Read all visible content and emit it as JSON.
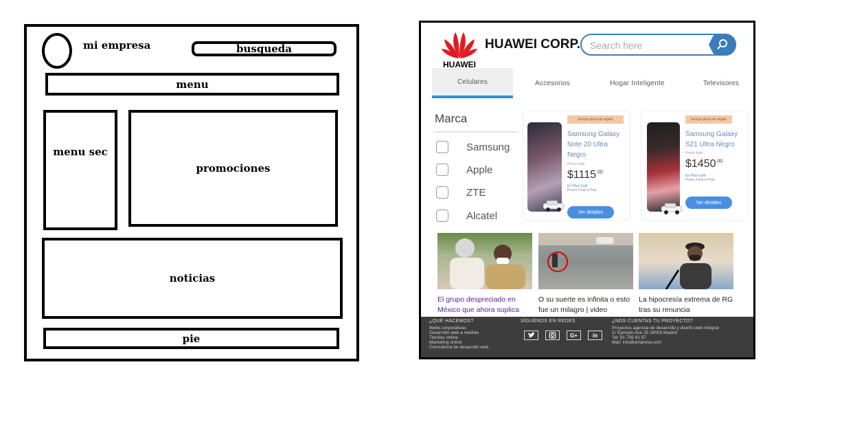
{
  "wireframe": {
    "company": "mi empresa",
    "search": "busqueda",
    "menu": "menu",
    "menu_sec": "menu sec",
    "promos": "promociones",
    "news": "noticias",
    "footer": "pie"
  },
  "site": {
    "logo_text": "HUAWEI",
    "brand": "HUAWEI CORP.",
    "search_placeholder": "Search here",
    "accent": "#3e8ad0",
    "tabs": [
      {
        "label": "Celulares",
        "active": true
      },
      {
        "label": "Accesorios",
        "active": false
      },
      {
        "label": "Hogar Inteligente",
        "active": false
      },
      {
        "label": "Televisores",
        "active": false
      }
    ],
    "filter": {
      "title": "Marca",
      "items": [
        "Samsung",
        "Apple",
        "ZTE",
        "Alcatel"
      ]
    },
    "products": [
      {
        "badge": "Incluye pieza de regalo",
        "name": "Samsung Galaxy Note 20 Ultra Negro",
        "note": "Precio total",
        "price": "$1115",
        "cents": ".00",
        "plan": "En Plan Gold",
        "plan_detail": "Precio Final el Plan",
        "button": "Ver detalles"
      },
      {
        "badge": "Incluye pieza de regalo",
        "name": "Samsung Galaxy S21 Ultra Negro",
        "note": "Precio total",
        "price": "$1450",
        "cents": ".00",
        "plan": "En Plan Gold",
        "plan_detail": "Precio Final el Plan",
        "button": "Ver detalles"
      }
    ],
    "news": [
      {
        "title": "El grupo despreciado en México que ahora suplica"
      },
      {
        "title": "O su suerte es infinita o esto fue un milagro | video"
      },
      {
        "title": "La hipocresía extrema de RG tras su renuncia"
      }
    ],
    "footer": {
      "col1_head": "¿QUÉ HACEMOS?",
      "col1_items": [
        "Webs corporativas",
        "Desarrollo web a medida",
        "Tiendas online",
        "Marketing online",
        "Consultoría de desarrollo web"
      ],
      "col2_head": "SÍGUENOS EN REDES",
      "col3_head": "¿NOS CUENTAS TU PROYECTO?",
      "col3_items": [
        "Proyectos agencia de desarrollo y diseño web integral",
        "C/ Ejemplo Ave 25 28000 Madrid",
        "Tel: 91 756 81 97",
        "Mail: info@empresa.com"
      ],
      "social": [
        "twitter-icon",
        "instagram-icon",
        "google-plus-icon",
        "linkedin-icon"
      ]
    }
  }
}
